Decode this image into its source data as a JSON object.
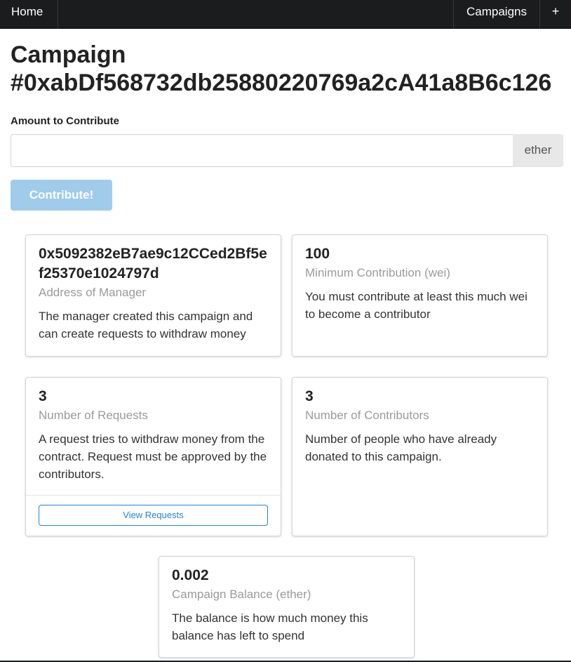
{
  "nav": {
    "home": "Home",
    "campaigns": "Campaigns",
    "add": "+"
  },
  "page": {
    "title_line1": "Campaign",
    "title_line2": "#0xabDf568732db25880220769a2cA41a8B6c126"
  },
  "contribute": {
    "label": "Amount to Contribute",
    "value": "",
    "placeholder": "",
    "unit": "ether",
    "button": "Contribute!"
  },
  "cards": [
    {
      "header": "0x5092382eB7ae9c12CCed2Bf5ef25370e1024797d",
      "meta": "Address of Manager",
      "description": "The manager created this campaign and can create requests to withdraw money"
    },
    {
      "header": "100",
      "meta": "Minimum Contribution (wei)",
      "description": "You must contribute at least this much wei to become a contributor"
    },
    {
      "header": "3",
      "meta": "Number of Requests",
      "description": "A request tries to withdraw money from the contract. Request must be approved by the contributors.",
      "action": "View Requests"
    },
    {
      "header": "3",
      "meta": "Number of Contributors",
      "description": "Number of people who have already donated to this campaign."
    },
    {
      "header": "0.002",
      "meta": "Campaign Balance (ether)",
      "description": "The balance is how much money this balance has left to spend"
    }
  ],
  "colors": {
    "navbar": "#1b1c1d",
    "primary": "#2185d0",
    "disabled_button": "#a0cbeb"
  }
}
